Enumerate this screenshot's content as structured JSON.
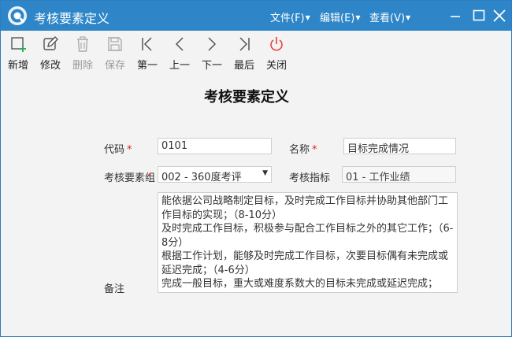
{
  "window": {
    "title": "考核要素定义"
  },
  "menu": [
    {
      "label": "文件(F)"
    },
    {
      "label": "编辑(E)"
    },
    {
      "label": "查看(V)"
    }
  ],
  "toolbar": [
    {
      "label": "新增",
      "icon": "add-icon",
      "enabled": true
    },
    {
      "label": "修改",
      "icon": "edit-icon",
      "enabled": true
    },
    {
      "label": "删除",
      "icon": "trash-icon",
      "enabled": false
    },
    {
      "label": "保存",
      "icon": "save-icon",
      "enabled": false
    },
    {
      "label": "第一",
      "icon": "first-icon",
      "enabled": true
    },
    {
      "label": "上一",
      "icon": "prev-icon",
      "enabled": true
    },
    {
      "label": "下一",
      "icon": "next-icon",
      "enabled": true
    },
    {
      "label": "最后",
      "icon": "last-icon",
      "enabled": true
    },
    {
      "label": "关闭",
      "icon": "power-icon",
      "enabled": true
    }
  ],
  "form": {
    "title": "考核要素定义",
    "code": {
      "label": "代码",
      "required": "*",
      "value": "0101"
    },
    "name": {
      "label": "名称",
      "required": "*",
      "value": "目标完成情况"
    },
    "group": {
      "label": "考核要素组",
      "required": "*",
      "value": "002 - 360度考评"
    },
    "indicator": {
      "label": "考核指标",
      "value": "01 - 工作业绩"
    },
    "remark": {
      "label": "备注",
      "lines": [
        "能依据公司战略制定目标，及时完成工作目标并协助其他部门工作目标的实现；（8-10分）",
        "及时完成工作目标，积极参与配合工作目标之外的其它工作；（6-8分）",
        "根据工作计划，能够及时完成工作目标，次要目标偶有未完成或延迟完成；（4-6分）",
        "完成一般目标，重大或难度系数大的目标未完成或延迟完成；"
      ]
    }
  },
  "colors": {
    "titlebar": "#2e86c8",
    "required": "#e0251b",
    "close_icon": "#e8413a"
  }
}
